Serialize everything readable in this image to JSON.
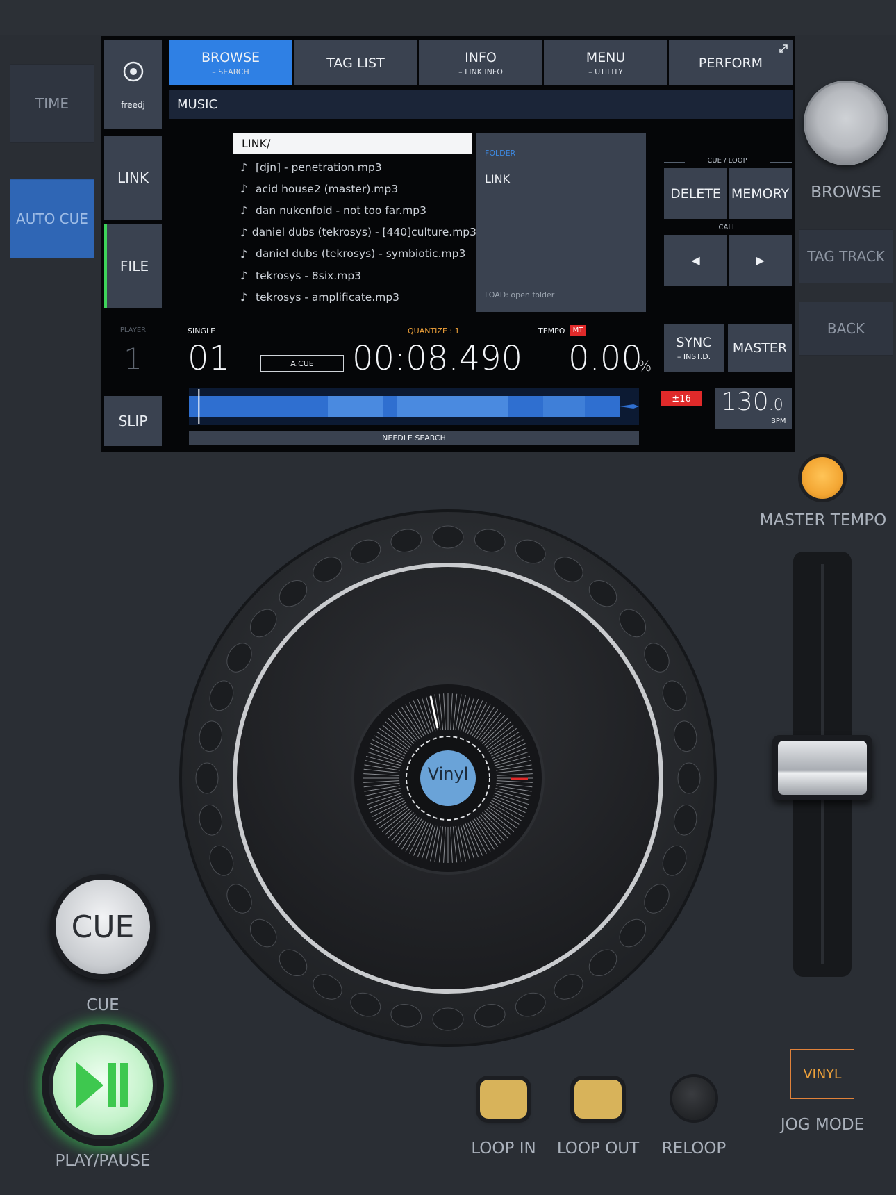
{
  "left_buttons": {
    "time": "TIME",
    "auto_cue": "AUTO CUE"
  },
  "screen": {
    "source": {
      "icon": "disc-icon",
      "label": "freedj"
    },
    "link_label": "LINK",
    "file_label": "FILE",
    "slip_label": "SLIP",
    "expand_icon": "expand-icon",
    "tabs": [
      {
        "label": "BROWSE",
        "sub": "– SEARCH",
        "active": true
      },
      {
        "label": "TAG LIST",
        "sub": ""
      },
      {
        "label": "INFO",
        "sub": "– LINK INFO"
      },
      {
        "label": "MENU",
        "sub": "– UTILITY"
      },
      {
        "label": "PERFORM",
        "sub": ""
      }
    ],
    "music_header": "MUSIC",
    "path": "LINK/",
    "files": [
      "[djn] - penetration.mp3",
      "acid house2 (master).mp3",
      "dan nukenfold - not too far.mp3",
      "daniel dubs (tekrosys) - [440]culture.mp3",
      "daniel dubs (tekrosys) - symbiotic.mp3",
      "tekrosys - 8six.mp3",
      "tekrosys - amplificate.mp3"
    ],
    "folder": {
      "type_label": "FOLDER",
      "name": "LINK",
      "hint": "LOAD: open folder"
    },
    "cue_loop": {
      "label": "CUE / LOOP",
      "delete": "DELETE",
      "memory": "MEMORY"
    },
    "call": {
      "label": "CALL",
      "prev_icon": "triangle-left-icon",
      "next_icon": "triangle-right-icon",
      "prev": "◀",
      "next": "▶"
    },
    "sync": {
      "label": "SYNC",
      "sub": "– INST.D."
    },
    "master": "MASTER",
    "player_label": "PLAYER",
    "player_number": "1",
    "mode": "SINGLE",
    "track_number": "01",
    "a_cue": "A.CUE",
    "quantize": "QUANTIZE : 1",
    "time": "00:08.490",
    "tempo_label": "TEMPO",
    "mt_badge": "MT",
    "tempo_value": "0.00",
    "tempo_unit": "%",
    "range_badge": "±16",
    "bpm_int": "130",
    "bpm_dec": ".0",
    "bpm_label": "BPM",
    "needle_search": "NEEDLE SEARCH",
    "playhead_fraction": 0.02
  },
  "right_controls": {
    "browse": "BROWSE",
    "tag_track": "TAG TRACK",
    "back": "BACK",
    "master_tempo": "MASTER TEMPO",
    "jog_mode_value": "VINYL",
    "jog_mode_label": "JOG MODE"
  },
  "deck": {
    "platter_label": "Vinyl",
    "cue_button": "CUE",
    "cue_label": "CUE",
    "play_pause_label": "PLAY/PAUSE",
    "play_icon": "play-pause-icon",
    "loop_in": "LOOP IN",
    "loop_out": "LOOP OUT",
    "reloop": "RELOOP",
    "pitch_fader_position": 0.5
  },
  "colors": {
    "accent_blue": "#2f80e4",
    "green": "#3ed35a",
    "orange": "#f0a23a",
    "red": "#e02a2a",
    "pad_yellow": "#d8b35a"
  }
}
